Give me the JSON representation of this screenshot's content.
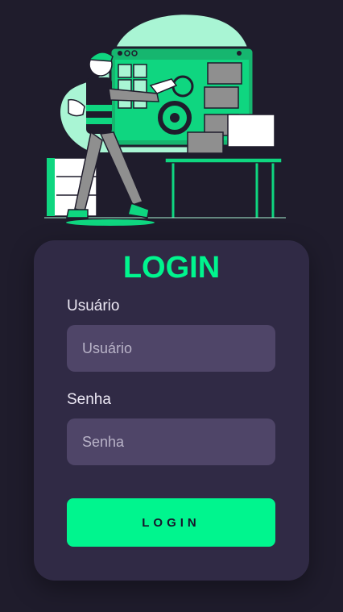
{
  "colors": {
    "background": "#1f1c2c",
    "card": "#302a45",
    "input": "#4f4568",
    "accent": "#00f58e",
    "accent_light": "#a9f5d4"
  },
  "illustration": {
    "icon": "maintenance-worker-illustration"
  },
  "login": {
    "title": "LOGIN",
    "username_label": "Usuário",
    "username_placeholder": "Usuário",
    "password_label": "Senha",
    "password_placeholder": "Senha",
    "submit_label": "LOGIN"
  }
}
